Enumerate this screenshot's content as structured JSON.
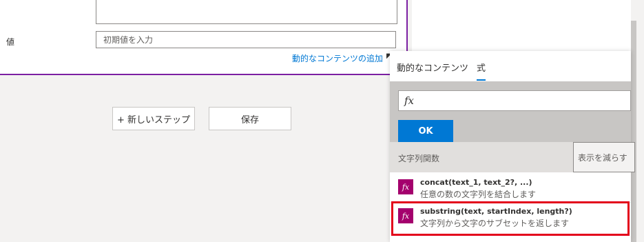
{
  "form": {
    "value_label": "値",
    "value_placeholder": "初期値を入力",
    "dynamic_content_link": "動的なコンテンツの追加"
  },
  "buttons": {
    "new_step": "+ 新しいステップ",
    "save": "保存"
  },
  "popup": {
    "tabs": [
      {
        "label": "動的なコンテンツ",
        "active": false
      },
      {
        "label": "式",
        "active": true
      }
    ],
    "expression_icon": "fx",
    "ok_label": "OK",
    "section_title": "文字列関数",
    "show_less": "表示を減らす",
    "functions": [
      {
        "name": "concat(text_1, text_2?, ...)",
        "description": "任意の数の文字列を結合します",
        "icon": "fx"
      },
      {
        "name": "substring(text, startIndex, length?)",
        "description": "文字列から文字のサブセットを返します",
        "icon": "fx",
        "highlighted": true
      }
    ]
  },
  "colors": {
    "accent": "#0078d4",
    "card_border": "#7b1fa2",
    "function_icon": "#a4006d",
    "highlight": "#e3001b"
  }
}
